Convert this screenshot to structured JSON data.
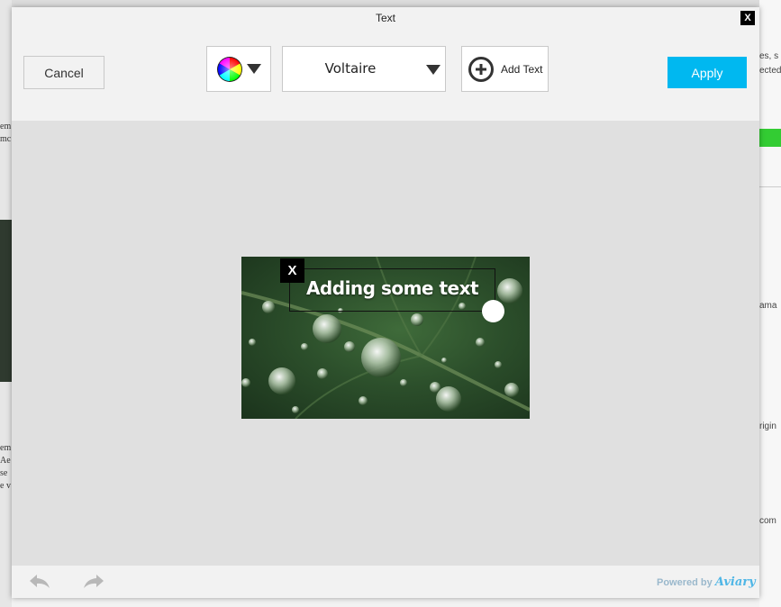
{
  "background_page": {
    "left_fragments": [
      "em",
      "mc",
      "em",
      "Ae",
      "se",
      "e v"
    ],
    "right_fragments": [
      "es, s",
      "ected",
      "ama",
      "rigin",
      "com"
    ]
  },
  "modal": {
    "title": "Text",
    "close_label": "X"
  },
  "toolbar": {
    "cancel_label": "Cancel",
    "font_name": "Voltaire",
    "add_text_label": "Add Text",
    "apply_label": "Apply",
    "color_picker_icon": "color-wheel-icon"
  },
  "canvas": {
    "overlay_text": "Adding some text",
    "remove_label": "X"
  },
  "footer": {
    "powered_by": "Powered by",
    "brand": "Aviary"
  },
  "colors": {
    "apply_bg": "#00b8f0",
    "toolbar_bg": "#f2f2f2",
    "canvas_bg": "#e0e0e0"
  }
}
